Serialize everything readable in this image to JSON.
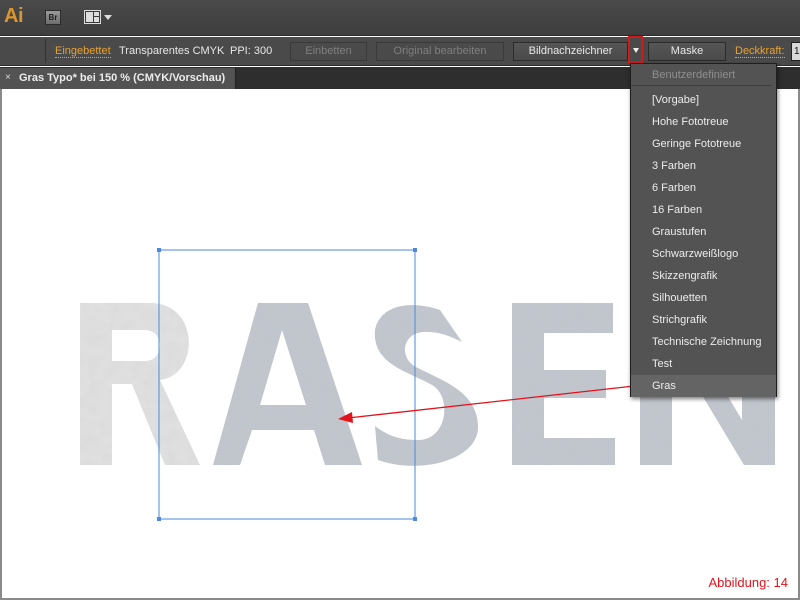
{
  "app": {
    "logo": "Ai",
    "bridge_label": "Br"
  },
  "controlbar": {
    "embedded_link": "Eingebettet",
    "color_mode": "Transparentes CMYK",
    "ppi": "PPI: 300",
    "embed_button": "Einbetten",
    "edit_original_button": "Original bearbeiten",
    "image_trace_button": "Bildnachzeichner",
    "mask_button": "Maske",
    "opacity_link": "Deckkraft:",
    "opacity_value": "1"
  },
  "document_tab": {
    "close": "×",
    "title": "Gras Typo* bei 150 % (CMYK/Vorschau)"
  },
  "artwork": {
    "text": "RASEN",
    "selection_color": "#4a8ae0",
    "annotation_color": "#e3131b"
  },
  "trace_presets_menu": {
    "header": "Benutzerdefiniert",
    "items": [
      {
        "label": "[Vorgabe]"
      },
      {
        "label": "Hohe Fototreue"
      },
      {
        "label": "Geringe Fototreue"
      },
      {
        "label": "3 Farben"
      },
      {
        "label": "6 Farben"
      },
      {
        "label": "16 Farben"
      },
      {
        "label": "Graustufen"
      },
      {
        "label": "Schwarzweißlogo"
      },
      {
        "label": "Skizzengrafik"
      },
      {
        "label": "Silhouetten"
      },
      {
        "label": "Strichgrafik"
      },
      {
        "label": "Technische Zeichnung"
      },
      {
        "label": "Test"
      },
      {
        "label": "Gras",
        "selected": true
      }
    ]
  },
  "figure_label": "Abbildung: 14"
}
